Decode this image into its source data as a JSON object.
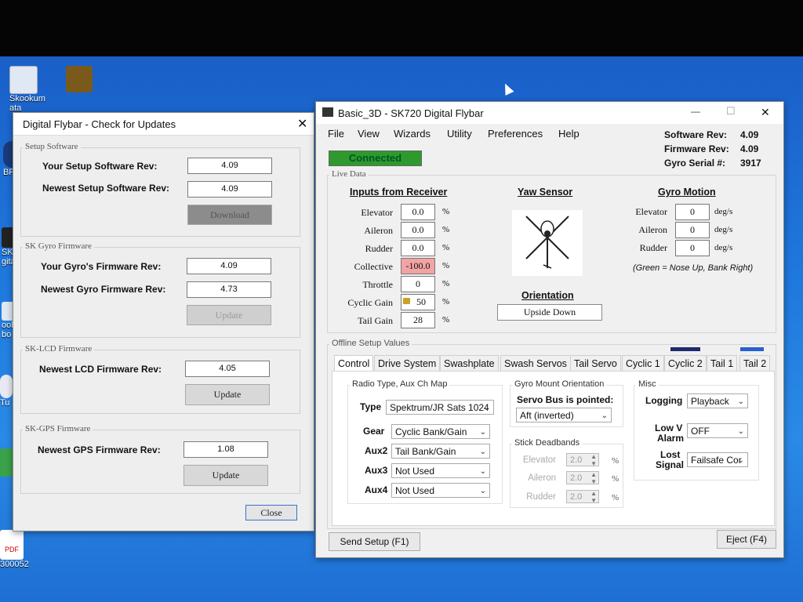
{
  "desktop": {
    "icons": [
      {
        "label": "Skookum"
      },
      {
        "label": "ata"
      },
      {
        "label": "BR"
      },
      {
        "label": "SK"
      },
      {
        "label": "gita"
      },
      {
        "label": "ook"
      },
      {
        "label": "bo"
      },
      {
        "label": "Tu"
      },
      {
        "label": "300052"
      }
    ],
    "pdf_label": "PDF"
  },
  "update_dialog": {
    "title": "Digital Flybar - Check for Updates",
    "close_x": "✕",
    "setup_software": {
      "group_title": "Setup Software",
      "your_label": "Your Setup Software Rev:",
      "your_value": "4.09",
      "newest_label": "Newest Setup Software Rev:",
      "newest_value": "4.09",
      "button": "Download"
    },
    "gyro_firmware": {
      "group_title": "SK Gyro Firmware",
      "your_label": "Your Gyro's Firmware Rev:",
      "your_value": "4.09",
      "newest_label": "Newest Gyro Firmware Rev:",
      "newest_value": "4.73",
      "button": "Update"
    },
    "lcd_firmware": {
      "group_title": "SK-LCD Firmware",
      "newest_label": "Newest LCD Firmware Rev:",
      "newest_value": "4.05",
      "button": "Update"
    },
    "gps_firmware": {
      "group_title": "SK-GPS Firmware",
      "newest_label": "Newest GPS Firmware Rev:",
      "newest_value": "1.08",
      "button": "Update"
    },
    "close_button": "Close"
  },
  "main_window": {
    "title": "Basic_3D - SK720 Digital Flybar",
    "min": "—",
    "max": "☐",
    "close": "✕",
    "menu": [
      "File",
      "View",
      "Wizards",
      "Utility",
      "Preferences",
      "Help"
    ],
    "software_rev_label": "Software Rev:",
    "software_rev": "4.09",
    "firmware_rev_label": "Firmware Rev:",
    "firmware_rev": "4.09",
    "gyro_serial_label": "Gyro Serial #:",
    "gyro_serial": "3917",
    "status": "Connected",
    "live_data_title": "Live Data",
    "inputs_header": "Inputs from Receiver",
    "inputs": [
      {
        "label": "Elevator",
        "value": "0.0",
        "unit": "%"
      },
      {
        "label": "Aileron",
        "value": "0.0",
        "unit": "%"
      },
      {
        "label": "Rudder",
        "value": "0.0",
        "unit": "%"
      },
      {
        "label": "Collective",
        "value": "-100.0",
        "unit": "%"
      },
      {
        "label": "Throttle",
        "value": "0",
        "unit": "%"
      },
      {
        "label": "Cyclic Gain",
        "value": "50",
        "unit": "%"
      },
      {
        "label": "Tail Gain",
        "value": "28",
        "unit": "%"
      }
    ],
    "yaw_header": "Yaw Sensor",
    "orientation_header": "Orientation",
    "orientation_value": "Upside Down",
    "gyro_header": "Gyro Motion",
    "gyro": [
      {
        "label": "Elevator",
        "value": "0",
        "unit": "deg/s"
      },
      {
        "label": "Aileron",
        "value": "0",
        "unit": "deg/s"
      },
      {
        "label": "Rudder",
        "value": "0",
        "unit": "deg/s"
      }
    ],
    "gyro_note": "(Green = Nose Up, Bank Right)",
    "offline_title": "Offline Setup Values",
    "tabs": [
      "Control",
      "Drive System",
      "Swashplate",
      "Swash Servos",
      "Tail Servo",
      "Cyclic 1",
      "Cyclic 2",
      "Tail 1",
      "Tail 2"
    ],
    "radio": {
      "title": "Radio Type, Aux Ch Map",
      "type_label": "Type",
      "type_value": "Spektrum/JR Sats 1024",
      "gear_label": "Gear",
      "gear_value": "Cyclic Bank/Gain",
      "aux2_label": "Aux2",
      "aux2_value": "Tail Bank/Gain",
      "aux3_label": "Aux3",
      "aux3_value": "Not Used",
      "aux4_label": "Aux4",
      "aux4_value": "Not Used"
    },
    "gyro_mount": {
      "title": "Gyro Mount Orientation",
      "servo_bus_label": "Servo Bus is pointed:",
      "servo_bus_value": "Aft (inverted)"
    },
    "deadbands": {
      "title": "Stick Deadbands",
      "items": [
        {
          "label": "Elevator",
          "value": "2.0",
          "unit": "%"
        },
        {
          "label": "Aileron",
          "value": "2.0",
          "unit": "%"
        },
        {
          "label": "Rudder",
          "value": "2.0",
          "unit": "%"
        }
      ]
    },
    "misc": {
      "title": "Misc",
      "logging_label": "Logging",
      "logging_value": "Playback",
      "lowv_label_1": "Low V",
      "lowv_label_2": "Alarm",
      "lowv_value": "OFF",
      "lost_label_1": "Lost",
      "lost_label_2": "Signal",
      "lost_value": "Failsafe Cor"
    },
    "send_button": "Send Setup (F1)",
    "eject_button": "Eject (F4)",
    "colors": {
      "connected": "#2e9a2e",
      "collective_alert": "#f2a3a3",
      "tab_marker": "#1c2a6e",
      "tab_marker_2": "#2a5fd0"
    }
  }
}
